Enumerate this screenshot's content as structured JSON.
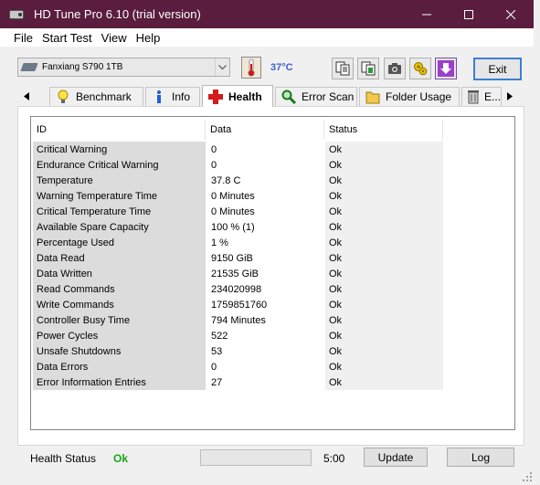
{
  "window": {
    "title": "HD Tune Pro 6.10 (trial version)"
  },
  "menu": {
    "items": [
      "File",
      "Start Test",
      "View",
      "Help"
    ]
  },
  "toolbar": {
    "drive": "Fanxiang S790 1TB",
    "temperature": "37°C",
    "exit_label": "Exit"
  },
  "tabs": [
    {
      "label": "Benchmark",
      "icon": "lightbulb-icon"
    },
    {
      "label": "Info",
      "icon": "info-icon"
    },
    {
      "label": "Health",
      "icon": "red-cross-icon",
      "active": true
    },
    {
      "label": "Error Scan",
      "icon": "magnifier-icon"
    },
    {
      "label": "Folder Usage",
      "icon": "folder-icon"
    },
    {
      "label": "E...",
      "icon": "trash-icon"
    }
  ],
  "health_table": {
    "columns": [
      "ID",
      "Data",
      "Status"
    ],
    "rows": [
      {
        "id": "Critical Warning",
        "data": "0",
        "status": "Ok"
      },
      {
        "id": "Endurance Critical Warning",
        "data": "0",
        "status": "Ok"
      },
      {
        "id": "Temperature",
        "data": "37.8 C",
        "status": "Ok"
      },
      {
        "id": "Warning Temperature Time",
        "data": "0 Minutes",
        "status": "Ok"
      },
      {
        "id": "Critical Temperature Time",
        "data": "0 Minutes",
        "status": "Ok"
      },
      {
        "id": "Available Spare Capacity",
        "data": "100 % (1)",
        "status": "Ok"
      },
      {
        "id": "Percentage Used",
        "data": "1 %",
        "status": "Ok"
      },
      {
        "id": "Data Read",
        "data": "9150 GiB",
        "status": "Ok"
      },
      {
        "id": "Data Written",
        "data": "21535 GiB",
        "status": "Ok"
      },
      {
        "id": "Read Commands",
        "data": "234020998",
        "status": "Ok"
      },
      {
        "id": "Write Commands",
        "data": "1759851760",
        "status": "Ok"
      },
      {
        "id": "Controller Busy Time",
        "data": "794 Minutes",
        "status": "Ok"
      },
      {
        "id": "Power Cycles",
        "data": "522",
        "status": "Ok"
      },
      {
        "id": "Unsafe Shutdowns",
        "data": "53",
        "status": "Ok"
      },
      {
        "id": "Data Errors",
        "data": "0",
        "status": "Ok"
      },
      {
        "id": "Error Information Entries",
        "data": "27",
        "status": "Ok"
      }
    ]
  },
  "bottom": {
    "health_status_label": "Health Status",
    "health_status_value": "Ok",
    "progress": 0,
    "timer": "5:00",
    "update_label": "Update",
    "log_label": "Log"
  },
  "colors": {
    "titlebar": "#5a1d3e",
    "temperature": "#3a62d2",
    "health_ok": "#1aa31a",
    "id_column_bg": "#dcdcdc",
    "status_column_bg": "#f0f0f0"
  }
}
